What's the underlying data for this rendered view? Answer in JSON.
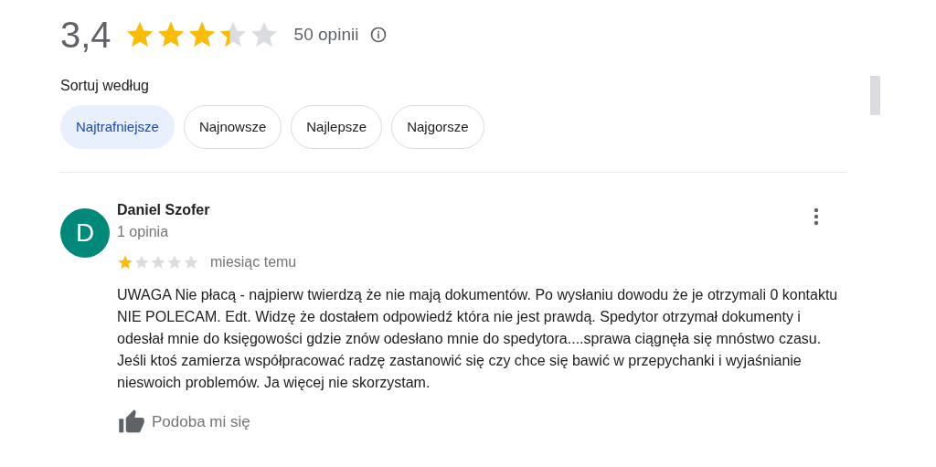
{
  "summary": {
    "rating": "3,4",
    "stars": 3.4,
    "count": "50 opinii"
  },
  "sort": {
    "label": "Sortuj według",
    "options": [
      {
        "label": "Najtrafniejsze",
        "selected": true
      },
      {
        "label": "Najnowsze",
        "selected": false
      },
      {
        "label": "Najlepsze",
        "selected": false
      },
      {
        "label": "Najgorsze",
        "selected": false
      }
    ]
  },
  "reviews": [
    {
      "initial": "D",
      "author": "Daniel Szofer",
      "author_reviews": "1 opinia",
      "stars": 1,
      "date": "miesiąc temu",
      "text": "UWAGA Nie płacą - najpierw twierdzą że nie mają dokumentów. Po wysłaniu dowodu że je otrzymali 0 kontaktu NIE POLECAM. Edt. Widzę że dostałem odpowiedź która nie jest prawdą. Spedytor otrzymał dokumenty i odesłał mnie do księgowości gdzie znów odesłano mnie do spedytora....sprawa ciągnęła się mnóstwo czasu. Jeśli ktoś zamierza współpracować radzę zastanowić się czy chce się bawić w przepychanki i wyjaśnianie nieswoich problemów. Ja więcej nie skorzystam.",
      "like": "Podoba mi się"
    }
  ]
}
